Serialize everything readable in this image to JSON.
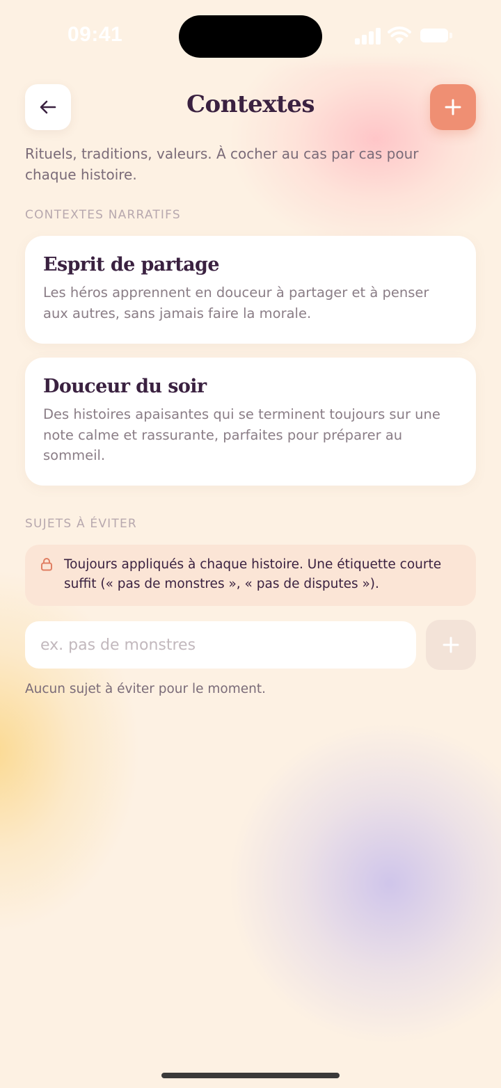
{
  "status_bar": {
    "time": "09:41",
    "icons": [
      "cellular-signal-icon",
      "wifi-icon",
      "battery-icon"
    ]
  },
  "header": {
    "title": "Contextes",
    "back_icon": "arrow-left-icon",
    "add_icon": "plus-icon"
  },
  "subtitle": "Rituels, traditions, valeurs. À cocher au cas par cas pour chaque histoire.",
  "narrative_section": {
    "label": "CONTEXTES NARRATIFS",
    "cards": [
      {
        "title": "Esprit de partage",
        "description": "Les héros apprennent en douceur à partager et à penser aux autres, sans jamais faire la morale."
      },
      {
        "title": "Douceur du soir",
        "description": "Des histoires apaisantes qui se terminent toujours sur une note calme et rassurante, parfaites pour préparer au sommeil."
      }
    ]
  },
  "avoid_section": {
    "label": "SUJETS À ÉVITER",
    "notice_icon": "lock-icon",
    "notice": "Toujours appliqués à chaque histoire. Une étiquette courte suffit (« pas de monstres », « pas de disputes »).",
    "input": {
      "value": "",
      "placeholder": "ex. pas de monstres"
    },
    "add_icon": "plus-icon",
    "empty_text": "Aucun sujet à éviter pour le moment."
  },
  "colors": {
    "background": "#fdf1e3",
    "accent": "#ef8f73",
    "title_text": "#3a2140",
    "body_text": "#7a6b78",
    "notice_bg": "#fbe5d6"
  }
}
